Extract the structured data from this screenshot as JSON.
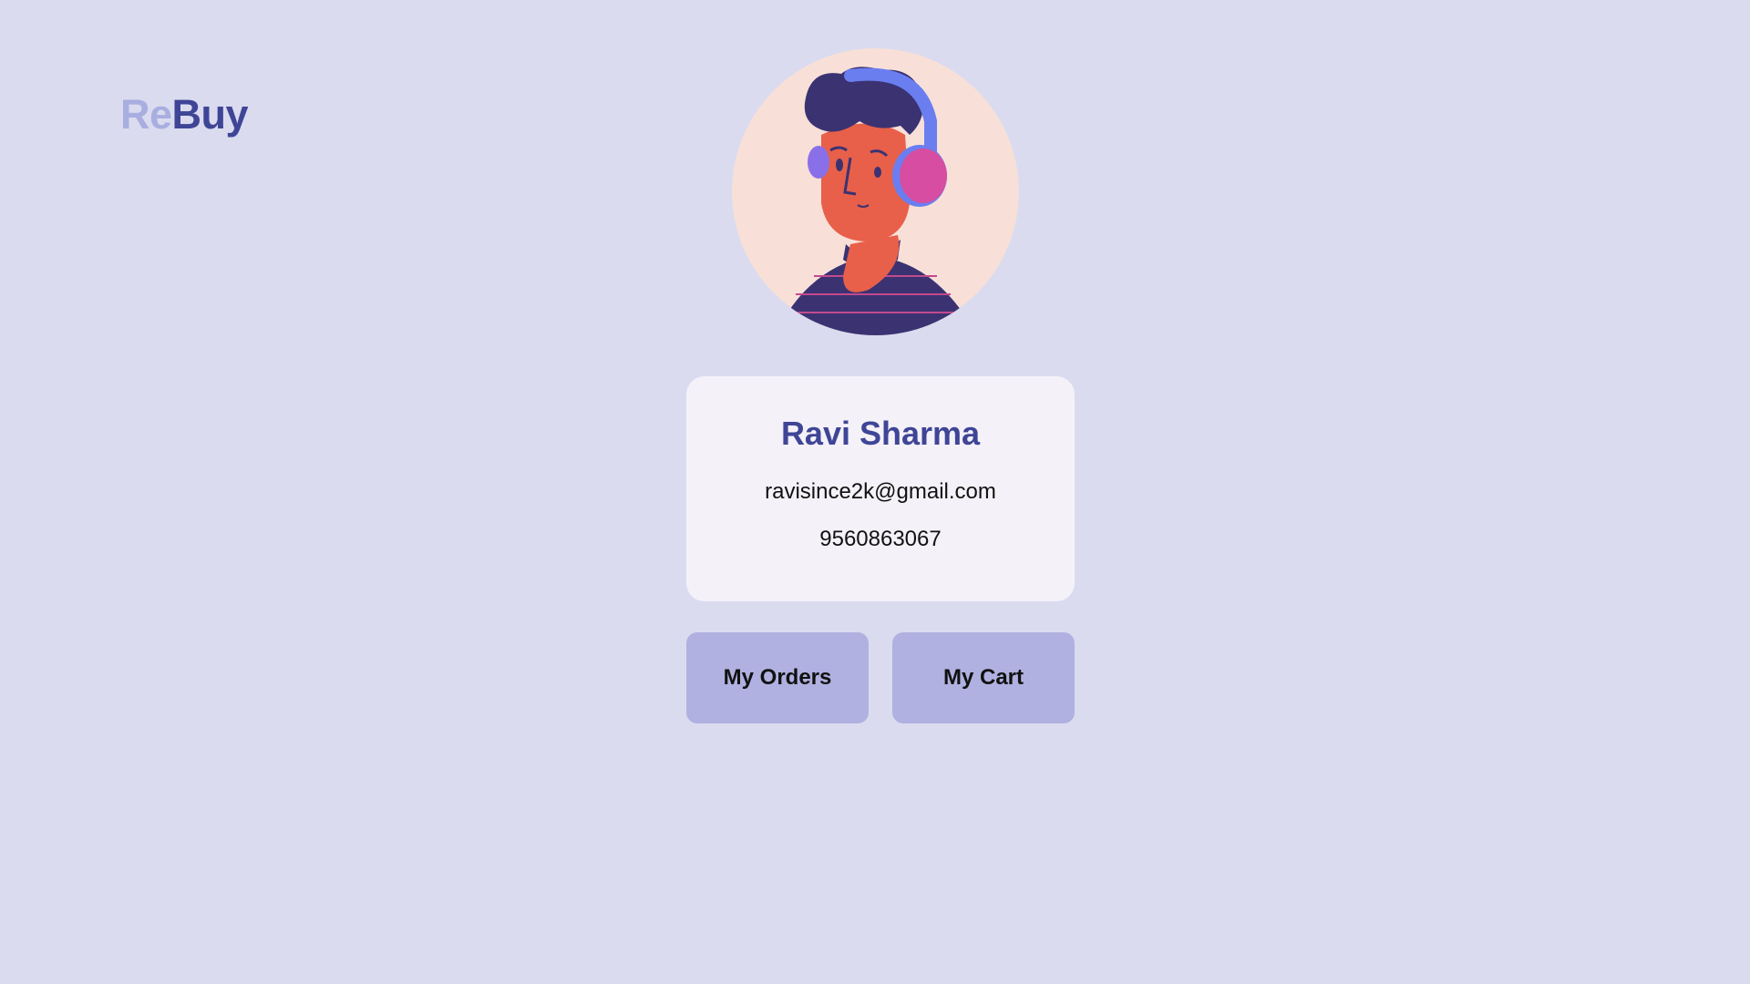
{
  "brand": {
    "logo_part1": "Re",
    "logo_part2": "Buy",
    "accent_color": "#3f4596",
    "light_accent_color": "#a9aee0"
  },
  "avatar": {
    "icon": "user-avatar-illustration"
  },
  "profile": {
    "name": "Ravi Sharma",
    "email": "ravisince2k@gmail.com",
    "phone": "9560863067"
  },
  "actions": {
    "orders_label": "My Orders",
    "cart_label": "My Cart"
  }
}
